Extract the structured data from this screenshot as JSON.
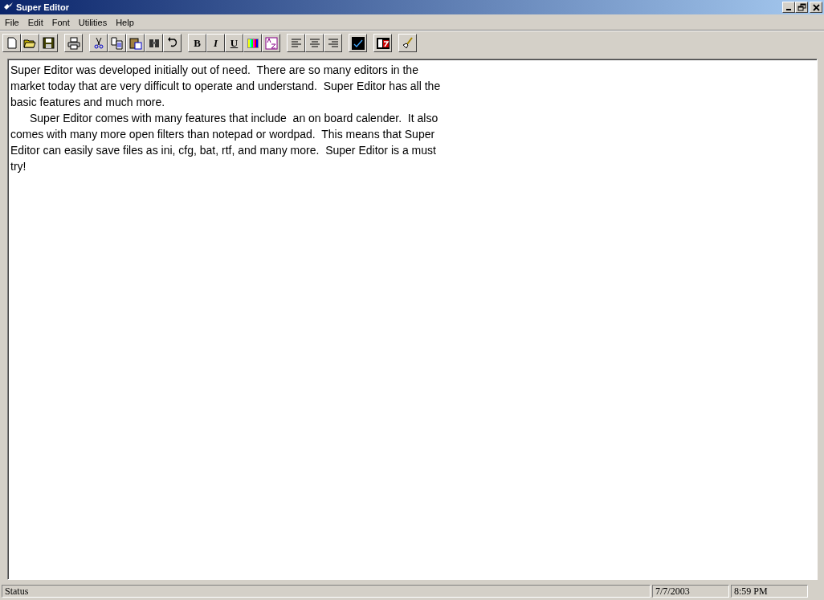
{
  "window": {
    "title": "Super Editor"
  },
  "menu": [
    "File",
    "Edit",
    "Font",
    "Utilities",
    "Help"
  ],
  "toolbar": [
    [
      {
        "kind": "icon"
      },
      {
        "kind": "icon"
      },
      {
        "kind": "icon"
      }
    ],
    [
      {
        "kind": "icon"
      }
    ],
    [
      {
        "kind": "icon"
      },
      {
        "kind": "icon"
      },
      {
        "kind": "icon"
      },
      {
        "kind": "icon"
      },
      {
        "kind": "icon"
      }
    ],
    [
      {
        "kind": "text",
        "label": "B"
      },
      {
        "kind": "text",
        "label": "I"
      },
      {
        "kind": "text",
        "label": "U"
      },
      {
        "kind": "icon"
      },
      {
        "kind": "icon"
      }
    ],
    [
      {
        "kind": "icon"
      },
      {
        "kind": "icon"
      },
      {
        "kind": "icon"
      }
    ],
    [
      {
        "kind": "icon"
      }
    ],
    [
      {
        "kind": "icon"
      }
    ],
    [
      {
        "kind": "icon"
      }
    ]
  ],
  "document": {
    "lines": [
      {
        "text": "Super Editor was developed initially out of need.  There are so many editors in the",
        "indent": false
      },
      {
        "text": "market today that are very difficult to operate and understand.  Super Editor has all the",
        "indent": false
      },
      {
        "text": "basic features and much more.",
        "indent": false
      },
      {
        "text": "Super Editor comes with many features that include  an on board calender.  It also",
        "indent": true
      },
      {
        "text": "comes with many more open filters than notepad or wordpad.  This means that Super",
        "indent": false
      },
      {
        "text": "Editor can easily save files as ini, cfg, bat, rtf, and many more.  Super Editor is a must",
        "indent": false
      },
      {
        "text": "try!",
        "indent": false
      }
    ]
  },
  "status_bar": [
    "Status",
    "7/7/2003",
    "8:59 PM"
  ]
}
